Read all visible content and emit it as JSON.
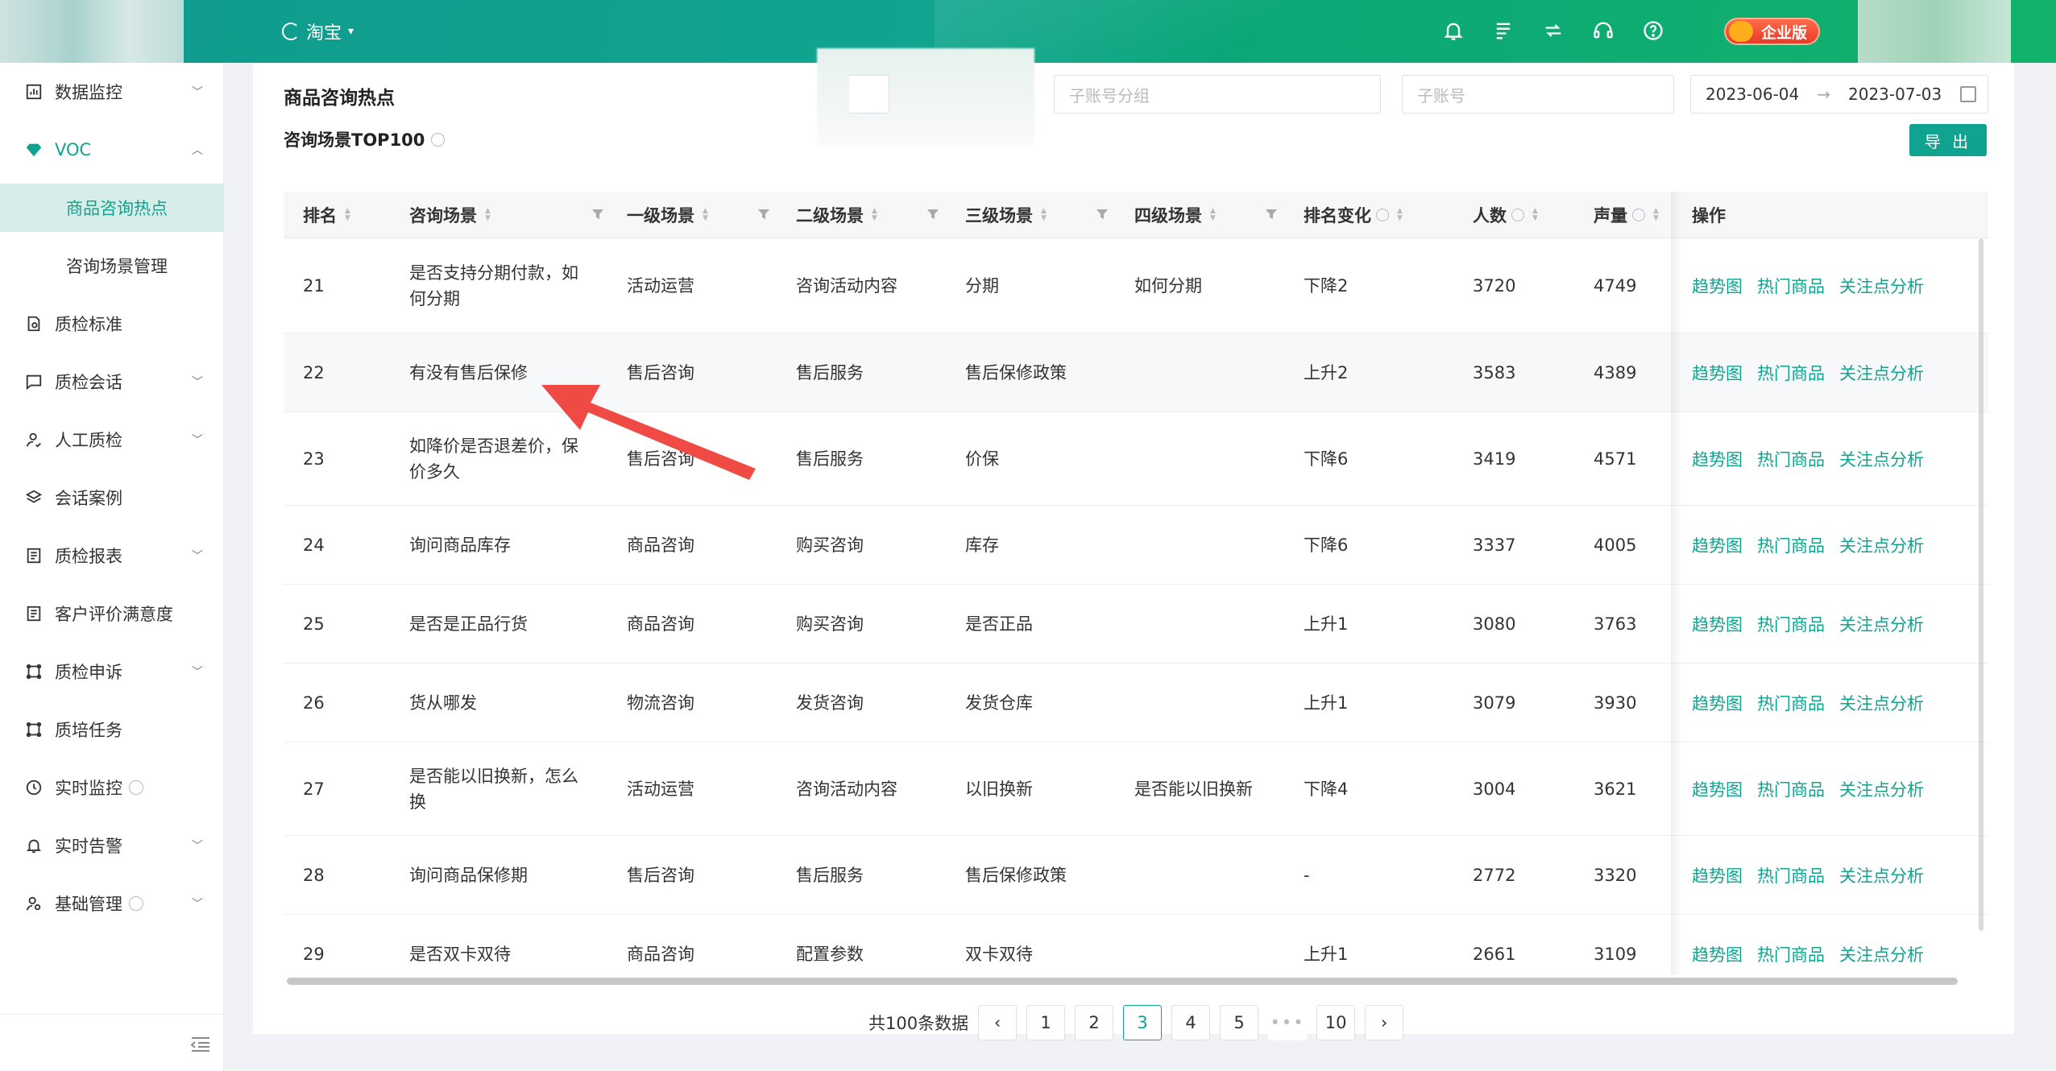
{
  "topbar": {
    "shop": "淘宝",
    "icons": [
      "bell-icon",
      "list-icon",
      "refresh-icon",
      "headset-icon",
      "help-icon"
    ],
    "edition": "企业版"
  },
  "sidebar": {
    "items": [
      {
        "label": "数据监控",
        "icon": "chart-icon",
        "arrow": "down"
      },
      {
        "label": "VOC",
        "icon": "diamond-icon",
        "arrow": "up",
        "open": true
      },
      {
        "label": "商品咨询热点",
        "sub": true,
        "active": true
      },
      {
        "label": "咨询场景管理",
        "sub": true
      },
      {
        "label": "质检标准",
        "icon": "doc-icon"
      },
      {
        "label": "质检会话",
        "icon": "chat-icon",
        "arrow": "down"
      },
      {
        "label": "人工质检",
        "icon": "user-icon",
        "arrow": "down"
      },
      {
        "label": "会话案例",
        "icon": "layers-icon"
      },
      {
        "label": "质检报表",
        "icon": "report-icon",
        "arrow": "down"
      },
      {
        "label": "客户评价满意度",
        "icon": "report-icon"
      },
      {
        "label": "质检申诉",
        "icon": "appeal-icon",
        "arrow": "down"
      },
      {
        "label": "质培任务",
        "icon": "task-icon"
      },
      {
        "label": "实时监控",
        "icon": "clock-icon",
        "info": true
      },
      {
        "label": "实时告警",
        "icon": "alarm-icon",
        "arrow": "down"
      },
      {
        "label": "基础管理",
        "icon": "settings-user-icon",
        "info": true,
        "arrow": "down"
      }
    ]
  },
  "main": {
    "title": "商品咨询热点",
    "filters": {
      "group_placeholder": "子账号分组",
      "account_placeholder": "子账号"
    },
    "date_start": "2023-06-04",
    "date_sep": "→",
    "date_end": "2023-07-03",
    "section_title": "咨询场景TOP100",
    "export_label": "导 出"
  },
  "table": {
    "headers": [
      "排名",
      "咨询场景",
      "一级场景",
      "二级场景",
      "三级场景",
      "四级场景",
      "排名变化",
      "人数",
      "声量",
      "操作"
    ],
    "rows": [
      {
        "rank": "21",
        "scene": "是否支持分期付款，如何分期",
        "l1": "活动运营",
        "l2": "咨询活动内容",
        "l3": "分期",
        "l4": "如何分期",
        "change": "下降2",
        "people": "3720",
        "volume": "4749"
      },
      {
        "rank": "22",
        "scene": "有没有售后保修",
        "l1": "售后咨询",
        "l2": "售后服务",
        "l3": "售后保修政策",
        "l4": "",
        "change": "上升2",
        "people": "3583",
        "volume": "4389"
      },
      {
        "rank": "23",
        "scene": "如降价是否退差价，保价多久",
        "l1": "售后咨询",
        "l2": "售后服务",
        "l3": "价保",
        "l4": "",
        "change": "下降6",
        "people": "3419",
        "volume": "4571"
      },
      {
        "rank": "24",
        "scene": "询问商品库存",
        "l1": "商品咨询",
        "l2": "购买咨询",
        "l3": "库存",
        "l4": "",
        "change": "下降6",
        "people": "3337",
        "volume": "4005"
      },
      {
        "rank": "25",
        "scene": "是否是正品行货",
        "l1": "商品咨询",
        "l2": "购买咨询",
        "l3": "是否正品",
        "l4": "",
        "change": "上升1",
        "people": "3080",
        "volume": "3763"
      },
      {
        "rank": "26",
        "scene": "货从哪发",
        "l1": "物流咨询",
        "l2": "发货咨询",
        "l3": "发货仓库",
        "l4": "",
        "change": "上升1",
        "people": "3079",
        "volume": "3930"
      },
      {
        "rank": "27",
        "scene": "是否能以旧换新，怎么换",
        "l1": "活动运营",
        "l2": "咨询活动内容",
        "l3": "以旧换新",
        "l4": "是否能以旧换新",
        "change": "下降4",
        "people": "3004",
        "volume": "3621"
      },
      {
        "rank": "28",
        "scene": "询问商品保修期",
        "l1": "售后咨询",
        "l2": "售后服务",
        "l3": "售后保修政策",
        "l4": "",
        "change": "-",
        "people": "2772",
        "volume": "3320"
      },
      {
        "rank": "29",
        "scene": "是否双卡双待",
        "l1": "商品咨询",
        "l2": "配置参数",
        "l3": "双卡双待",
        "l4": "",
        "change": "上升1",
        "people": "2661",
        "volume": "3109"
      }
    ],
    "actions": [
      "趋势图",
      "热门商品",
      "关注点分析"
    ]
  },
  "pagination": {
    "total": "共100条数据",
    "pages": [
      "1",
      "2",
      "3",
      "4",
      "5",
      "10"
    ],
    "current": "3",
    "ellipsis": "•••"
  },
  "colors": {
    "accent": "#10a38f",
    "annotation": "#f04a44"
  }
}
